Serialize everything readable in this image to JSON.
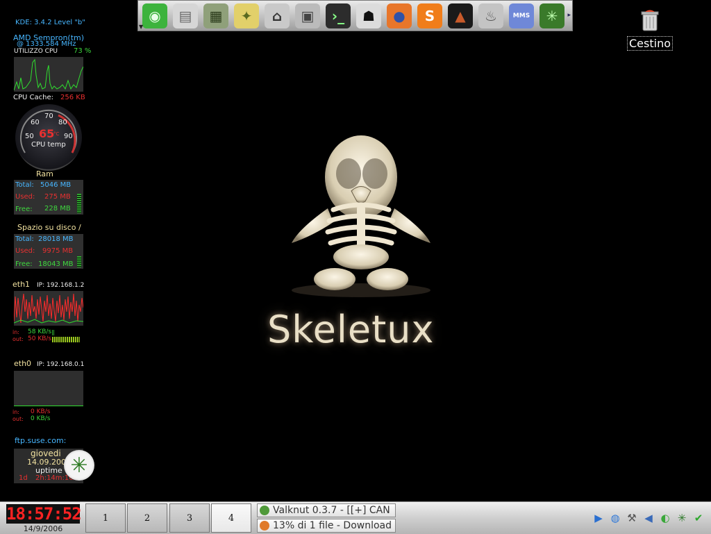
{
  "launcher": {
    "icons": [
      {
        "icon": "suse-menu-icon",
        "glyph": "◉",
        "bg": "#3db33d",
        "fg": "#e8ffe8"
      },
      {
        "icon": "computer-icon",
        "glyph": "▤",
        "bg": "#d6d6d6",
        "fg": "#666"
      },
      {
        "icon": "control-center-icon",
        "glyph": "▦",
        "bg": "#8fa07a",
        "fg": "#2a3a1a"
      },
      {
        "icon": "settings-tools-icon",
        "glyph": "✦",
        "bg": "#e2d06a",
        "fg": "#5a6a20"
      },
      {
        "icon": "home-folder-icon",
        "glyph": "⌂",
        "bg": "#c9c9c9",
        "fg": "#333"
      },
      {
        "icon": "package-manager-icon",
        "glyph": "▣",
        "bg": "#bbbbbb",
        "fg": "#444"
      },
      {
        "icon": "terminal-icon",
        "glyph": "›_",
        "bg": "#2c2c2c",
        "fg": "#8f8"
      },
      {
        "icon": "ghost-icon",
        "glyph": "☗",
        "bg": "#dcdcdc",
        "fg": "#111"
      },
      {
        "icon": "firefox-icon",
        "glyph": "●",
        "bg": "#e8762a",
        "fg": "#3052a8"
      },
      {
        "icon": "skype-icon",
        "glyph": "S",
        "bg": "#f07d1a",
        "fg": "#fff"
      },
      {
        "icon": "triangle-app-icon",
        "glyph": "▲",
        "bg": "#1a1a1a",
        "fg": "#c85a2a"
      },
      {
        "icon": "bell-service-icon",
        "glyph": "♨",
        "bg": "#c4c4c4",
        "fg": "#555"
      },
      {
        "icon": "mms-icon",
        "glyph": "MMS",
        "bg": "#6f88d8",
        "fg": "#fff"
      },
      {
        "icon": "cannabis-leaf-icon",
        "glyph": "✳",
        "bg": "#3a7a2a",
        "fg": "#bfffb0"
      }
    ]
  },
  "monitor": {
    "kde_version": "KDE: 3.4.2 Level \"b\"",
    "cpu_name": "AMD Sempron(tm)",
    "cpu_freq": "@ 1333.584 MHz",
    "cpu_usage_label": "UTILIZZO CPU",
    "cpu_usage_value": "73 %",
    "cpu_cache_label": "CPU Cache:",
    "cpu_cache_value": "256 KB",
    "gauge": {
      "ticks": [
        "50",
        "60",
        "70",
        "80",
        "90"
      ],
      "temp": "65",
      "unit": "°C",
      "label": "CPU temp"
    },
    "ram": {
      "title": "Ram",
      "total_label": "Total:",
      "total_value": "5046 MB",
      "used_label": "Used:",
      "used_value": "275 MB",
      "free_label": "Free:",
      "free_value": "228 MB"
    },
    "disk": {
      "title": "Spazio su disco /",
      "total_label": "Total:",
      "total_value": "28018 MB",
      "used_label": "Used:",
      "used_value": "9975 MB",
      "free_label": "Free:",
      "free_value": "18043 MB"
    },
    "eth1": {
      "name": "eth1",
      "ip": "IP: 192.168.1.2",
      "in_label": "in:",
      "in_value": "58 KB/s",
      "out_label": "out:",
      "out_value": "50 KB/s"
    },
    "eth0": {
      "name": "eth0",
      "ip": "IP: 192.168.0.1",
      "in_label": "in:",
      "in_value": "0 KB/s",
      "out_label": "out:",
      "out_value": "0 KB/s"
    },
    "ftp": "ftp.suse.com:",
    "calendar": {
      "day": "giovedi",
      "date": "14.09.2006",
      "uptime_label": "uptime",
      "uptime_days": "1d",
      "uptime_time": "2h:14m:16s"
    }
  },
  "desktop": {
    "logo_text": "Skeletux",
    "trash_label": "Cestino"
  },
  "panel": {
    "clock": "18:57:52",
    "date": "14/9/2006",
    "desktops": [
      "1",
      "2",
      "3",
      "4"
    ],
    "active_desktop": 4,
    "tasks": [
      {
        "label": "Valknut 0.3.7 - [[+] CAN",
        "icon_color": "#4f9a3a"
      },
      {
        "label": "13% di 1 file - Download",
        "icon_color": "#e07a2a"
      }
    ],
    "tray": [
      {
        "icon": "panel-arrow-icon",
        "glyph": "▶",
        "color": "#2a6fd0"
      },
      {
        "icon": "network-globe-icon",
        "glyph": "◍",
        "color": "#2f78d8"
      },
      {
        "icon": "tools-icon",
        "glyph": "⚒",
        "color": "#555"
      },
      {
        "icon": "volume-icon",
        "glyph": "◀",
        "color": "#3a6ab8"
      },
      {
        "icon": "suse-chameleon-icon",
        "glyph": "◐",
        "color": "#3aa83a"
      },
      {
        "icon": "leaf-tray-icon",
        "glyph": "✳",
        "color": "#2e7a2a"
      },
      {
        "icon": "check-update-icon",
        "glyph": "✔",
        "color": "#2ea82e"
      },
      {
        "icon": "hide-panel-arrow-icon",
        "glyph": "▸",
        "color": "#2a4a8a"
      }
    ]
  }
}
